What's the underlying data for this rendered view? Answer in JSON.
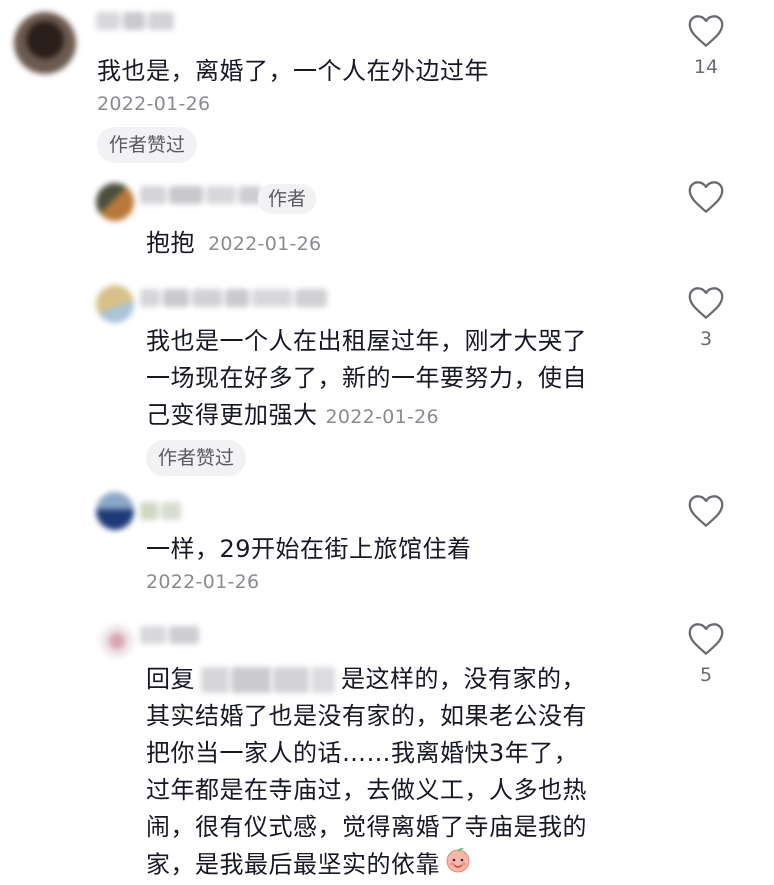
{
  "comments": [
    {
      "text": "我也是，离婚了，一个人在外边过年",
      "date": "2022-01-26",
      "chip": "作者赞过",
      "likes": "14"
    },
    {
      "text": "抱抱",
      "date": "2022-01-26",
      "author_tag": "作者"
    },
    {
      "lines": [
        "我也是一个人在出租屋过年，刚才大哭了",
        "一场现在好多了，新的一年要努力，使自",
        "己变得更加强大"
      ],
      "date": "2022-01-26",
      "chip": "作者赞过",
      "likes": "3"
    },
    {
      "text": "一样，29开始在街上旅馆住着",
      "date": "2022-01-26"
    },
    {
      "reply_label": "回复",
      "lines": [
        "是这样的，没有家的，",
        "其实结婚了也是没有家的，如果老公没有",
        "把你当一家人的话……我离婚快3年了，",
        "过年都是在寺庙过，去做义工，人多也热",
        "闹，很有仪式感，觉得离婚了寺庙是我的",
        "家，是我最后最坚实的依靠"
      ],
      "likes": "5"
    }
  ],
  "icons": {
    "like": "heart-outline-icon",
    "emoji": "peach-face-emoji-icon"
  }
}
